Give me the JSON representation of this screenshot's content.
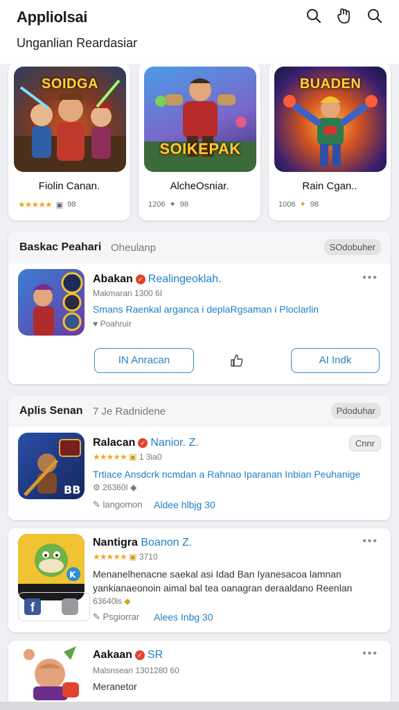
{
  "header": {
    "app_title": "Appliolsai",
    "subtitle": "Unganlian Reardasiar",
    "icons": [
      "search-icon",
      "hand-icon",
      "search-icon"
    ]
  },
  "featured": [
    {
      "art_title": "SOIDGA",
      "name": "Fiolin Canan.",
      "stars": "★★★★★",
      "meta": "98",
      "colors": [
        "#6b4a2b",
        "#c9402f",
        "#2f6fb5"
      ]
    },
    {
      "art_title": "SOIKEPAK",
      "name": "AlcheOsniar.",
      "stars": "",
      "meta": "1206",
      "meta2": "98",
      "colors": [
        "#3a7dd1",
        "#b92e2e",
        "#6b5aa0"
      ]
    },
    {
      "art_title": "BUADEN",
      "name": "Rain Cgan..",
      "stars": "",
      "meta": "1006",
      "meta2": "98",
      "colors": [
        "#1b2f7a",
        "#e07a1d",
        "#5a2b8c"
      ]
    }
  ],
  "section1": {
    "title": "Baskac Peahari",
    "sub": "Oheulanp",
    "pill": "SOdobuher",
    "app": {
      "name": "Abakan",
      "tag": "Realingeoklah.",
      "line1": "Makmaran  1300 6I",
      "desc": "Smans Raenkal arganca i deplaRgsaman i Ploclarlin",
      "line2": "Poahruir",
      "btn_left": "IN Anracan",
      "btn_right": "AI Indk"
    }
  },
  "section2": {
    "title": "Aplis Senan",
    "sub": "7 Je Radnidene",
    "pill": "Pdoduhar",
    "apps": [
      {
        "name": "Ralacan",
        "tag": "Nanior. Z.",
        "stars": "★★★★★",
        "rating_line": "1 3ia0",
        "pill": "Cnnr",
        "desc": "Trtiace Ansdcrk ncmdan a Rahnao Iparanan Inbian Peuhanige",
        "line2": "26360I",
        "foot_left": "langomon",
        "foot_right": "Aldee hlbjg 30"
      },
      {
        "name": "Nantigra",
        "tag": "Boanon Z.",
        "stars": "★★★★★",
        "rating_line": "3710",
        "desc1": "Menanelhenacne saekal asi Idad Ban Iyanesacoa lamnan",
        "desc2": "yankianaeonoin aimal bal tea oanagran deraaldano Reenlan",
        "line2": "63640ls",
        "foot_left": "Psgiorrar",
        "foot_right": "Alees Inbg 30"
      },
      {
        "name": "Aakaan",
        "tag": "SR",
        "line1": "Malsnsean  1301280 60",
        "desc": "Meranetor"
      }
    ]
  }
}
